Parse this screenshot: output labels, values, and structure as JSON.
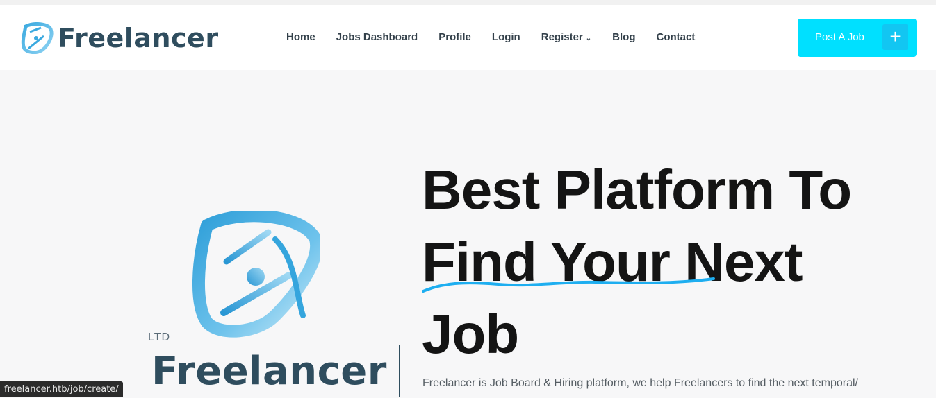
{
  "header": {
    "brand_name": "Freelancer",
    "nav": [
      {
        "label": "Home"
      },
      {
        "label": "Jobs Dashboard"
      },
      {
        "label": "Profile"
      },
      {
        "label": "Login"
      },
      {
        "label": "Register",
        "has_dropdown": true
      },
      {
        "label": "Blog"
      },
      {
        "label": "Contact"
      }
    ],
    "post_job_label": "Post A Job",
    "plus_glyph": "+"
  },
  "hero": {
    "ltd": "LTD",
    "brand_name": "Freelancer",
    "headline_line1": "Best Platform To",
    "headline_line2": "Find Your Next",
    "headline_line3": "Job",
    "description": "Freelancer is Job Board & Hiring platform, we help Freelancers to find the next temporal/"
  },
  "status_bar": {
    "url": "freelancer.htb/job/create/"
  },
  "colors": {
    "accent": "#00e0ff",
    "brand": "#2f4d5e",
    "underline": "#1eaef0"
  }
}
